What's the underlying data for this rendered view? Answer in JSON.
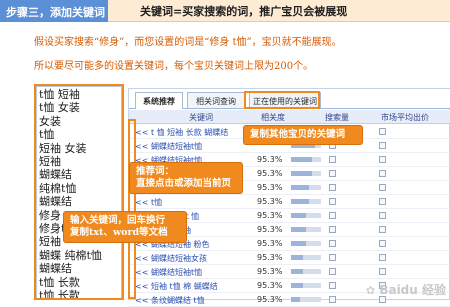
{
  "header": {
    "step_label": "步骤三，添加关键词",
    "title": "关键词=买家搜索的词，推广宝贝会被展现"
  },
  "help": {
    "line1": "假设买家搜索“修身”，而您设置的词是“修身 t恤”，宝贝就不能展现。",
    "line2": "所以要尽可能多的设置关键词，每个宝贝关键词上限为200个。"
  },
  "left_keywords": [
    "t恤 短袖",
    "t恤 女装",
    "女装",
    "t恤",
    "短袖 女装",
    "短袖",
    "蝴蝶结",
    "纯棉t恤",
    "蝴蝶结",
    "修身",
    "修身t恤",
    "短袖",
    "蝴蝶 纯棉t恤",
    "蝴蝶结",
    "t恤 长款",
    "t恤 长款"
  ],
  "tabs": [
    {
      "label": "系统推荐",
      "active": true
    },
    {
      "label": "相关词查询",
      "active": false
    },
    {
      "label": "正在使用的关键词",
      "active": false
    }
  ],
  "table": {
    "headers": {
      "keyword": "关键词",
      "relevance": "相关度",
      "search": "搜索量",
      "price": "市场平均出价"
    },
    "rows": [
      {
        "keyword": "<< t 恤 短袖 长款 蝴蝶结",
        "relevance": "",
        "fill": 0.9
      },
      {
        "keyword": "<< 蝴蝶结短袖t恤",
        "relevance": "",
        "fill": 0.8
      },
      {
        "keyword": "<< 蝴蝶结短袖t恤",
        "relevance": "95.3%",
        "fill": 0.7
      },
      {
        "keyword": "<< 蝴蝶结短袖t恤",
        "relevance": "95.3%",
        "fill": 0.7
      },
      {
        "keyword": "<< 蝴蝶结短袖t恤",
        "relevance": "95.3%",
        "fill": 0.6
      },
      {
        "keyword": "<< t恤",
        "relevance": "95.3%",
        "fill": 0.6
      },
      {
        "keyword": "<< 修身纯棉 t 恤",
        "relevance": "95.3%",
        "fill": 0.5
      },
      {
        "keyword": "<< 蝴蝶结短袖",
        "relevance": "95.3%",
        "fill": 0.5
      },
      {
        "keyword": "<< 蝴蝶结短袖 粉色",
        "relevance": "95.3%",
        "fill": 0.5
      },
      {
        "keyword": "<< 蝴蝶结短袖女孩",
        "relevance": "95.3%",
        "fill": 0.4
      },
      {
        "keyword": "<< 蝴蝶结短袖t恤",
        "relevance": "95.3%",
        "fill": 0.4
      },
      {
        "keyword": "<< 短袖 t恤 棉 蝴蝶结",
        "relevance": "95.3%",
        "fill": 0.4
      },
      {
        "keyword": "<< 条纹蝴蝶结 t恤",
        "relevance": "95.3%",
        "fill": 0.3
      }
    ]
  },
  "callouts": {
    "copy_other": "复制其他宝贝的关键词",
    "recommend_title": "推荐词：",
    "recommend_body": "直接点击或添加当前页",
    "input_title": "输入关键词，回车换行",
    "input_body": "复制txt、word等文档"
  },
  "watermark": "Baidu 经验",
  "colors": {
    "accent": "#f08a1e",
    "step_tab": "#5b8fd6",
    "help_text": "#d65a00",
    "link": "#2b4fb2"
  }
}
